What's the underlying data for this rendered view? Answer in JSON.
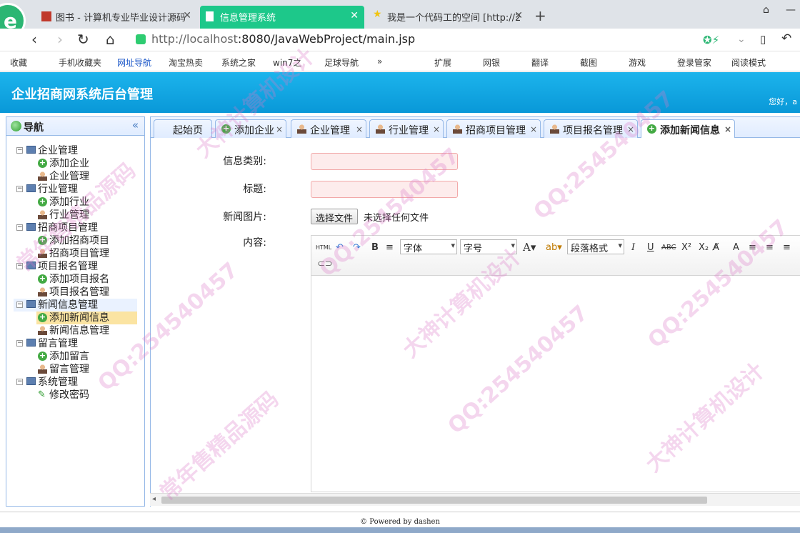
{
  "browser": {
    "tabs": [
      {
        "title": "图书 - 计算机专业毕业设计源码"
      },
      {
        "title": "信息管理系统"
      },
      {
        "title": "我是一个代码工的空间 [http://2"
      }
    ],
    "url_host": "http://localhost",
    "url_rest": ":8080/JavaWebProject/main.jsp",
    "bookmarks": [
      "收藏",
      "手机收藏夹",
      "网址导航",
      "淘宝热卖",
      "系统之家",
      "win7之",
      "足球导航",
      "»",
      "扩展",
      "网银",
      "翻译",
      "截图",
      "游戏",
      "登录管家",
      "阅读模式"
    ]
  },
  "app": {
    "title": "企业招商网系统后台管理",
    "greeting": "您好，a"
  },
  "sidebar": {
    "title": "导航",
    "collapse": "«",
    "groups": [
      {
        "label": "企业管理",
        "items": [
          "添加企业",
          "企业管理"
        ]
      },
      {
        "label": "行业管理",
        "items": [
          "添加行业",
          "行业管理"
        ]
      },
      {
        "label": "招商项目管理",
        "items": [
          "添加招商项目",
          "招商项目管理"
        ]
      },
      {
        "label": "项目报名管理",
        "items": [
          "添加项目报名",
          "项目报名管理"
        ]
      },
      {
        "label": "新闻信息管理",
        "items": [
          "添加新闻信息",
          "新闻信息管理"
        ]
      },
      {
        "label": "留言管理",
        "items": [
          "添加留言",
          "留言管理"
        ]
      },
      {
        "label": "系统管理",
        "items": [
          "修改密码"
        ]
      }
    ]
  },
  "tabs": [
    "起始页",
    "添加企业",
    "企业管理",
    "行业管理",
    "招商项目管理",
    "项目报名管理",
    "添加新闻信息"
  ],
  "form": {
    "category_label": "信息类别:",
    "title_label": "标题:",
    "image_label": "新闻图片:",
    "file_button": "选择文件",
    "file_status": "未选择任何文件",
    "content_label": "内容:",
    "editor": {
      "font": "字体",
      "size": "字号",
      "paragraph": "段落格式"
    }
  },
  "footer": "© Powered by dashen",
  "watermarks": [
    "大神计算机设计",
    "QQ:254540457",
    "常年售精品源码"
  ]
}
